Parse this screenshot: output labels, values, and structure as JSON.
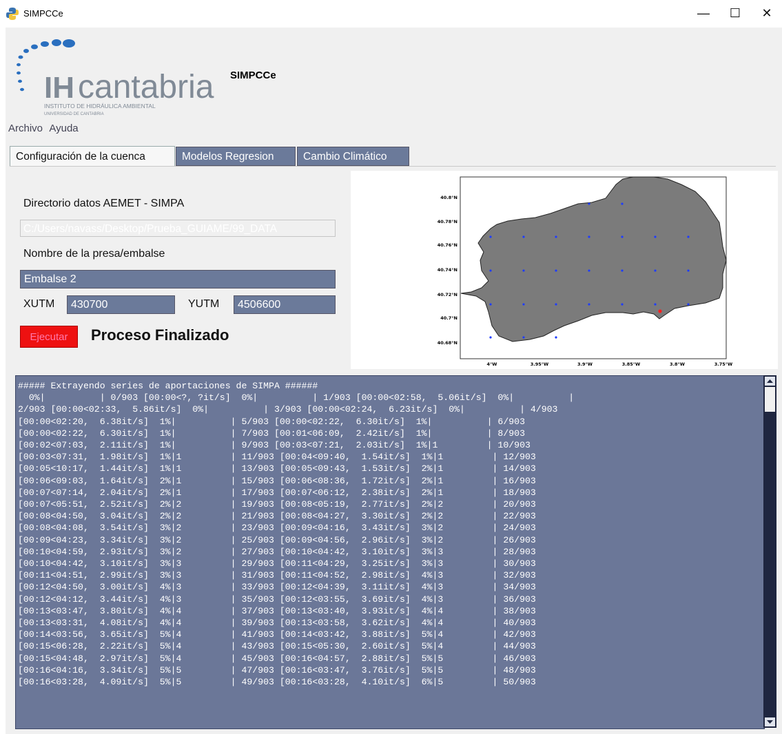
{
  "window": {
    "title": "SIMPCCe",
    "minimize": "—",
    "maximize": "☐",
    "close": "✕"
  },
  "header": {
    "logo_text": "IH cantabria",
    "logo_subtitle_1": "INSTITUTO DE HIDRÁULICA AMBIENTAL",
    "logo_subtitle_2": "UNIVERSIDAD DE CANTABRIA",
    "app_name": "SIMPCCe"
  },
  "menu": [
    "Archivo",
    "Ayuda"
  ],
  "tabs": [
    "Configuración de la cuenca",
    "Modelos Regresion",
    "Cambio Climático"
  ],
  "form": {
    "dir_label": "Directorio datos AEMET - SIMPA",
    "dir_value": "C:/Users/navass/Desktop/Prueba_GUIAME/99_DATA",
    "name_label": "Nombre de la presa/embalse",
    "name_value": "Embalse 2",
    "xutm_label": "XUTM",
    "xutm_value": "430700",
    "yutm_label": "YUTM",
    "yutm_value": "4506600",
    "run_button": "Ejecutar",
    "status": "Proceso Finalizado"
  },
  "map": {
    "lat_labels": [
      "40.8°N",
      "40.78°N",
      "40.76°N",
      "40.74°N",
      "40.72°N",
      "40.7°N",
      "40.68°N"
    ],
    "lon_labels": [
      "4°W",
      "3.95°W",
      "3.9°W",
      "3.85°W",
      "3.8°W",
      "3.75°W"
    ],
    "basin_color": "#7b7b7b",
    "station_color": "#1e3cff",
    "dam_color": "#ff2020"
  },
  "console": {
    "text": "##### Extrayendo series de aportaciones de SIMPA ######\n  0%|          | 0/903 [00:00<?, ?it/s]  0%|          | 1/903 [00:00<02:58,  5.06it/s]  0%|          |\n2/903 [00:00<02:33,  5.86it/s]  0%|          | 3/903 [00:00<02:24,  6.23it/s]  0%|          | 4/903\n[00:00<02:20,  6.38it/s]  1%|          | 5/903 [00:00<02:22,  6.30it/s]  1%|          | 6/903\n[00:00<02:22,  6.30it/s]  1%|          | 7/903 [00:01<06:09,  2.42it/s]  1%|          | 8/903\n[00:02<07:03,  2.11it/s]  1%|          | 9/903 [00:03<07:21,  2.03it/s]  1%|1         | 10/903\n[00:03<07:31,  1.98it/s]  1%|1         | 11/903 [00:04<09:40,  1.54it/s]  1%|1         | 12/903\n[00:05<10:17,  1.44it/s]  1%|1         | 13/903 [00:05<09:43,  1.53it/s]  2%|1         | 14/903\n[00:06<09:03,  1.64it/s]  2%|1         | 15/903 [00:06<08:36,  1.72it/s]  2%|1         | 16/903\n[00:07<07:14,  2.04it/s]  2%|1         | 17/903 [00:07<06:12,  2.38it/s]  2%|1         | 18/903\n[00:07<05:51,  2.52it/s]  2%|2         | 19/903 [00:08<05:19,  2.77it/s]  2%|2         | 20/903\n[00:08<04:50,  3.04it/s]  2%|2         | 21/903 [00:08<04:27,  3.30it/s]  2%|2         | 22/903\n[00:08<04:08,  3.54it/s]  3%|2         | 23/903 [00:09<04:16,  3.43it/s]  3%|2         | 24/903\n[00:09<04:23,  3.34it/s]  3%|2         | 25/903 [00:09<04:56,  2.96it/s]  3%|2         | 26/903\n[00:10<04:59,  2.93it/s]  3%|2         | 27/903 [00:10<04:42,  3.10it/s]  3%|3         | 28/903\n[00:10<04:42,  3.10it/s]  3%|3         | 29/903 [00:11<04:29,  3.25it/s]  3%|3         | 30/903\n[00:11<04:51,  2.99it/s]  3%|3         | 31/903 [00:11<04:52,  2.98it/s]  4%|3         | 32/903\n[00:12<04:50,  3.00it/s]  4%|3         | 33/903 [00:12<04:39,  3.11it/s]  4%|3         | 34/903\n[00:12<04:12,  3.44it/s]  4%|3         | 35/903 [00:12<03:55,  3.69it/s]  4%|3         | 36/903\n[00:13<03:47,  3.80it/s]  4%|4         | 37/903 [00:13<03:40,  3.93it/s]  4%|4         | 38/903\n[00:13<03:31,  4.08it/s]  4%|4         | 39/903 [00:13<03:58,  3.62it/s]  4%|4         | 40/903\n[00:14<03:56,  3.65it/s]  5%|4         | 41/903 [00:14<03:42,  3.88it/s]  5%|4         | 42/903\n[00:15<06:28,  2.22it/s]  5%|4         | 43/903 [00:15<05:30,  2.60it/s]  5%|4         | 44/903\n[00:15<04:48,  2.97it/s]  5%|4         | 45/903 [00:16<04:57,  2.88it/s]  5%|5         | 46/903\n[00:16<04:16,  3.34it/s]  5%|5         | 47/903 [00:16<03:47,  3.76it/s]  5%|5         | 48/903\n[00:16<03:28,  4.09it/s]  5%|5         | 49/903 [00:16<03:28,  4.10it/s]  6%|5         | 50/903"
  }
}
